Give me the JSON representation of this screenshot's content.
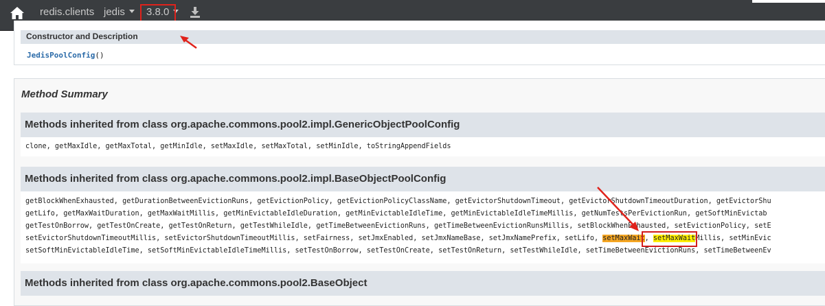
{
  "navbar": {
    "group": "redis.clients",
    "artifact": "jedis",
    "version": "3.8.0",
    "icons": [
      "home-icon",
      "download-icon"
    ]
  },
  "constructor_table": {
    "header": "Constructor and Description",
    "name": "JedisPoolConfig",
    "params": "()"
  },
  "method_summary": {
    "title": "Method Summary",
    "sections": [
      {
        "header": "Methods inherited from class org.apache.commons.pool2.impl.GenericObjectPoolConfig",
        "lines": [
          "clone, getMaxIdle, getMaxTotal, getMinIdle, setMaxIdle, setMaxTotal, setMinIdle, toStringAppendFields"
        ]
      },
      {
        "header": "Methods inherited from class org.apache.commons.pool2.impl.BaseObjectPoolConfig",
        "lines": [
          "getBlockWhenExhausted, getDurationBetweenEvictionRuns, getEvictionPolicy, getEvictionPolicyClassName, getEvictorShutdownTimeout, getEvictorShutdownTimeoutDuration, getEvictorShu",
          "getLifo, getMaxWaitDuration, getMaxWaitMillis, getMinEvictableIdleDuration, getMinEvictableIdleTime, getMinEvictableIdleTimeMillis, getNumTestsPerEvictionRun, getSoftMinEvictab",
          "getTestOnBorrow, getTestOnCreate, getTestOnReturn, getTestWhileIdle, getTimeBetweenEvictionRuns, getTimeBetweenEvictionRunsMillis, setBlockWhenExhausted, setEvictionPolicy, setE",
          "",
          "setSoftMinEvictableIdleTime, setSoftMinEvictableIdleTimeMillis, setTestOnBorrow, setTestOnCreate, setTestOnReturn, setTestWhileIdle, setTimeBetweenEvictionRuns, setTimeBetweenEv"
        ],
        "line4": {
          "before": "setEvictorShutdownTimeoutMillis, setEvictorShutdownTimeoutMillis, setFairness, setJmxEnabled, setJmxNameBase, setJmxNamePrefix, setLifo, ",
          "highlight_orange": "setMaxWait",
          "comma": ", ",
          "highlight_yellow": "setMaxWait",
          "after": "Millis, setMinEvic"
        }
      },
      {
        "header": "Methods inherited from class org.apache.commons.pool2.BaseObject",
        "lines": []
      }
    ]
  },
  "colors": {
    "navbar_bg": "#3a3d40",
    "header_bg": "#dee3e9",
    "annotation_red": "#e0221b",
    "highlight_orange": "#f5a623",
    "highlight_yellow": "#ffee00"
  }
}
